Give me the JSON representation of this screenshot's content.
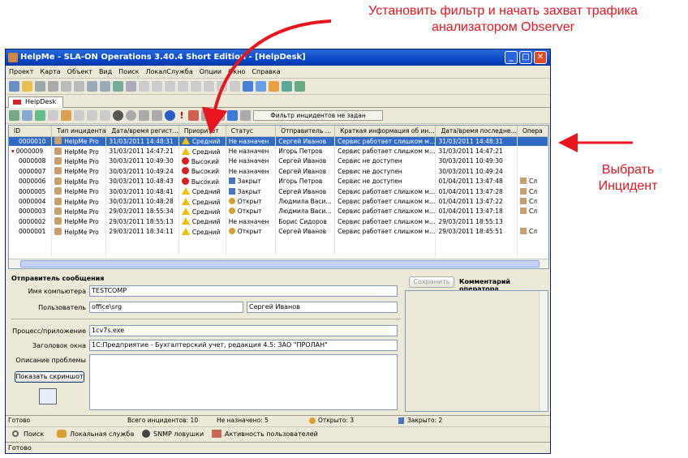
{
  "annotations": {
    "top": "Установить фильтр и начать захват трафика анализатором Observer",
    "right": "Выбрать Инцидент"
  },
  "window": {
    "title": "HelpMe - SLA-ON Operations 3.40.4 Short Edition - [HelpDesk]"
  },
  "menu": [
    "Проект",
    "Карта",
    "Объект",
    "Вид",
    "Поиск",
    "ЛокалСлужба",
    "Опции",
    "Окно",
    "Справка"
  ],
  "tab": "HelpDesk",
  "filter_label": "Фильтр инцидентов не задан",
  "columns": [
    "ID",
    "Тип инцидента",
    "Дата/время регист…",
    "Приоритет",
    "Статус",
    "Отправитель …",
    "Краткая информация об ин…",
    "Дата/время последне…",
    "Опера"
  ],
  "rows": [
    {
      "id": "0000010",
      "type": "HelpMe Pro",
      "date": "31/03/2011 14:48:31",
      "prio": "Средний",
      "prio_kind": "warn",
      "status": "Не назначен",
      "status_kind": "none",
      "sender": "Сергей Иванов",
      "info": "Сервис работает слишком м…",
      "last": "31/03/2011 14:48:31",
      "op": "",
      "sel": true
    },
    {
      "id": "0000009",
      "type": "HelpMe Pro",
      "date": "31/03/2011 14:47:21",
      "prio": "Средний",
      "prio_kind": "warn",
      "status": "Не назначен",
      "status_kind": "none",
      "sender": "Игорь Петров",
      "info": "Сервис работает слишком м…",
      "last": "31/03/2011 14:47:21",
      "op": ""
    },
    {
      "id": "0000008",
      "type": "HelpMe Pro",
      "date": "30/03/2011 10:49:30",
      "prio": "Высокий",
      "prio_kind": "high",
      "status": "Не назначен",
      "status_kind": "none",
      "sender": "Сергей Иванов",
      "info": "Сервис не доступен",
      "last": "30/03/2011 10:49:30",
      "op": ""
    },
    {
      "id": "0000007",
      "type": "HelpMe Pro",
      "date": "30/03/2011 10:49:24",
      "prio": "Высокий",
      "prio_kind": "high",
      "status": "Не назначен",
      "status_kind": "none",
      "sender": "Сергей Иванов",
      "info": "Сервис не доступен",
      "last": "30/03/2011 10:49:24",
      "op": ""
    },
    {
      "id": "0000006",
      "type": "HelpMe Pro",
      "date": "30/03/2011 10:48:43",
      "prio": "Высокий",
      "prio_kind": "high",
      "status": "Закрыт",
      "status_kind": "closed",
      "sender": "Игорь Петров",
      "info": "Сервис не доступен",
      "last": "01/04/2011 13:47:48",
      "op": "Сл"
    },
    {
      "id": "0000005",
      "type": "HelpMe Pro",
      "date": "30/03/2011 10:48:41",
      "prio": "Средний",
      "prio_kind": "warn",
      "status": "Закрыт",
      "status_kind": "closed",
      "sender": "Сергей Иванов",
      "info": "Сервис работает слишком м…",
      "last": "01/04/2011 13:47:28",
      "op": "Сл"
    },
    {
      "id": "0000004",
      "type": "HelpMe Pro",
      "date": "30/03/2011 10:48:28",
      "prio": "Средний",
      "prio_kind": "warn",
      "status": "Открыт",
      "status_kind": "open",
      "sender": "Людмила Васи…",
      "info": "Сервис работает слишком м…",
      "last": "01/04/2011 13:47:22",
      "op": "Сл"
    },
    {
      "id": "0000003",
      "type": "HelpMe Pro",
      "date": "29/03/2011 18:55:34",
      "prio": "Средний",
      "prio_kind": "warn",
      "status": "Открыт",
      "status_kind": "open",
      "sender": "Людмила Васи…",
      "info": "Сервис работает слишком м…",
      "last": "01/04/2011 13:47:18",
      "op": "Сл"
    },
    {
      "id": "0000002",
      "type": "HelpMe Pro",
      "date": "29/03/2011 18:55:13",
      "prio": "Средний",
      "prio_kind": "warn",
      "status": "Не назначен",
      "status_kind": "none",
      "sender": "Борис Сидоров",
      "info": "Сервис работает слишком м…",
      "last": "29/03/2011 18:55:13",
      "op": ""
    },
    {
      "id": "0000001",
      "type": "HelpMe Pro",
      "date": "29/03/2011 18:34:11",
      "prio": "Средний",
      "prio_kind": "warn",
      "status": "Открыт",
      "status_kind": "open",
      "sender": "Сергей Иванов",
      "info": "Сервис работает слишком м…",
      "last": "29/03/2011 18:45:51",
      "op": "Сл"
    }
  ],
  "detail": {
    "sender_heading": "Отправитель сообщения",
    "computer_label": "Имя компьютера",
    "computer": "TESTCOMP",
    "user_label": "Пользователь",
    "user_login": "office\\srg",
    "user_name": "Сергей Иванов",
    "process_label": "Процесс/приложение",
    "process": "1cv7s.exe",
    "wintitle_label": "Заголовок окна",
    "wintitle": "1С:Предприятие - Бухгалтерский учет, редакция 4.5: ЗАО \"ПРОЛАН\"",
    "problem_label": "Описание проблемы",
    "screenshot_btn": "Показать скриншот",
    "save_btn": "Сохранить",
    "comment_heading": "Комментарий оператора"
  },
  "status": {
    "ready": "Готово",
    "total": "Всего инцидентов: 10",
    "unassigned": "Не назначено: 5",
    "open": "Открыто: 3",
    "closed": "Закрыто: 2"
  },
  "nav": {
    "search": "Поиск",
    "local": "Локальная служба",
    "snmp": "SNMP ловушки",
    "activity": "Активность пользователей"
  },
  "bottom_status": "Готово"
}
